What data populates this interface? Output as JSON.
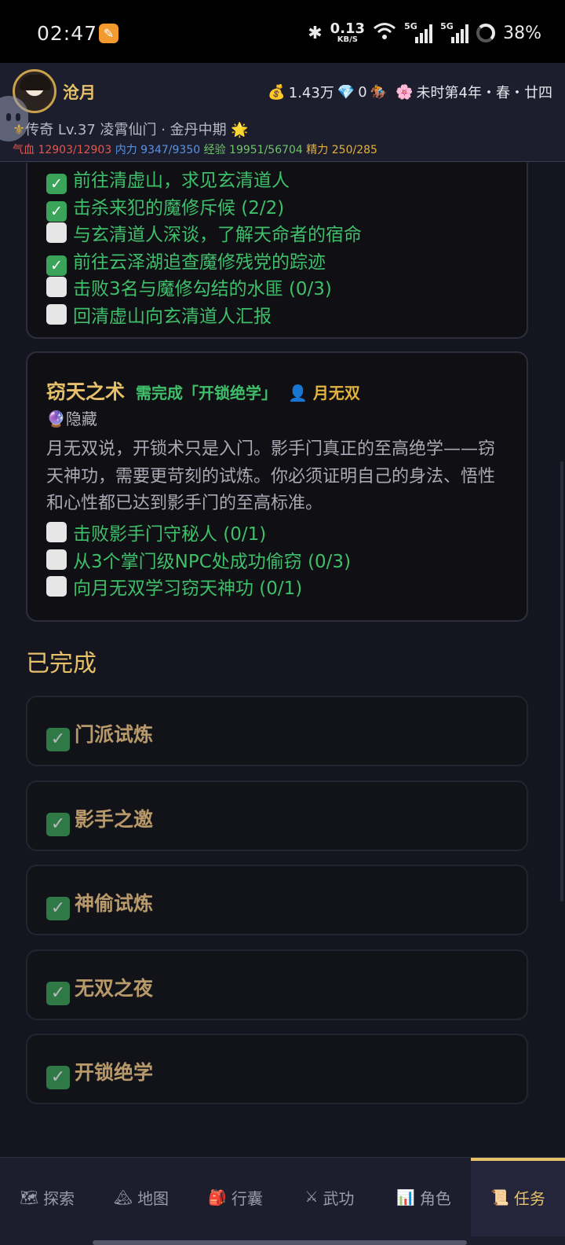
{
  "status_bar": {
    "time": "02:47",
    "speed_value": "0.13",
    "speed_unit": "KB/S",
    "battery": "38%",
    "network1": "5G",
    "network2": "5G"
  },
  "player": {
    "name": "沧月",
    "gold": "1.43万",
    "gems": "0",
    "date": "未时第4年・春・廿四",
    "rank_line": "传奇 Lv.37 凌霄仙门 · 金丹中期",
    "hp_label": "气血",
    "hp": "12903/12903",
    "mp_label": "内力",
    "mp": "9347/9350",
    "xp_label": "经验",
    "xp": "19951/56704",
    "en_label": "精力",
    "en": "250/285"
  },
  "quest1": {
    "objectives": [
      {
        "done": true,
        "text": "前往清虚山，求见玄清道人"
      },
      {
        "done": true,
        "text": "击杀来犯的魔修斥候 (2/2)"
      },
      {
        "done": false,
        "text": "与玄清道人深谈，了解天命者的宿命"
      },
      {
        "done": true,
        "text": "前往云泽湖追查魔修残党的踪迹"
      },
      {
        "done": false,
        "text": "击败3名与魔修勾结的水匪 (0/3)"
      },
      {
        "done": false,
        "text": "回清虚山向玄清道人汇报"
      }
    ]
  },
  "quest2": {
    "title": "窃天之术",
    "requirement": "需完成「开锁绝学」",
    "npc": "月无双",
    "tag": "隐藏",
    "description": "月无双说，开锁术只是入门。影手门真正的至高绝学——窃天神功，需要更苛刻的试炼。你必须证明自己的身法、悟性和心性都已达到影手门的至高标准。",
    "objectives": [
      {
        "done": false,
        "text": "击败影手门守秘人 (0/1)"
      },
      {
        "done": false,
        "text": "从3个掌门级NPC处成功偷窃 (0/3)"
      },
      {
        "done": false,
        "text": "向月无双学习窃天神功 (0/1)"
      }
    ]
  },
  "completed": {
    "title": "已完成",
    "items": [
      "门派试炼",
      "影手之邀",
      "神偷试炼",
      "无双之夜",
      "开锁绝学"
    ]
  },
  "nav": {
    "items": [
      {
        "icon": "map-picture-icon",
        "label": "探索"
      },
      {
        "icon": "mountain-icon",
        "label": "地图"
      },
      {
        "icon": "backpack-icon",
        "label": "行囊"
      },
      {
        "icon": "crossed-swords-icon",
        "label": "武功"
      },
      {
        "icon": "bar-chart-icon",
        "label": "角色"
      },
      {
        "icon": "scroll-icon",
        "label": "任务"
      }
    ],
    "active": "任务"
  },
  "colors": {
    "accent": "#e7c06a",
    "objective": "#3fbf6a",
    "hp": "#e4574e",
    "mp": "#5a93e6",
    "xp": "#6fc46a",
    "en": "#e3b23c"
  }
}
